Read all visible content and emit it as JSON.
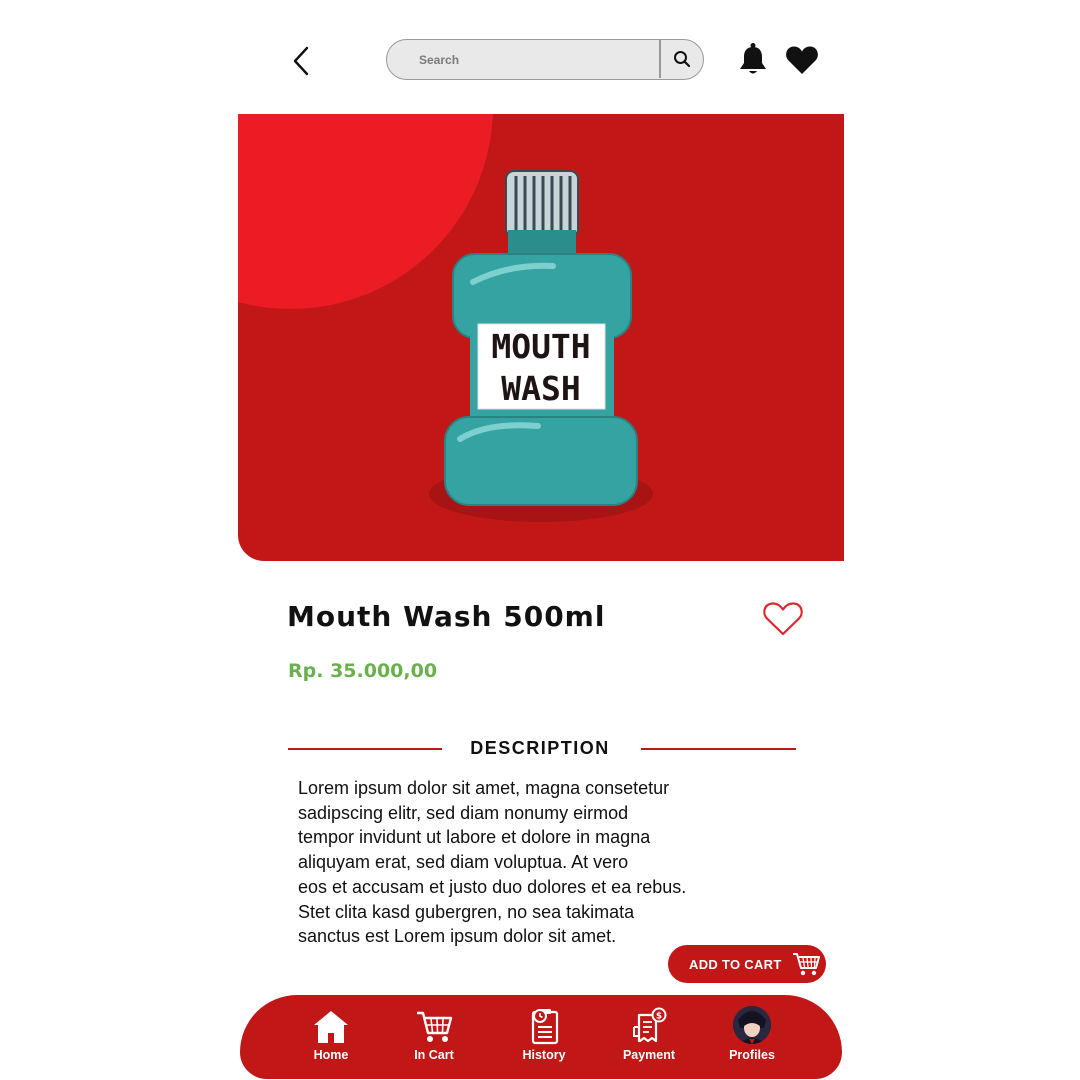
{
  "header": {
    "search_placeholder": "Search",
    "icons": {
      "back": "chevron-left-icon",
      "search": "magnifier-icon",
      "notifications": "bell-icon",
      "wishlist": "heart-icon"
    }
  },
  "hero": {
    "label_line1": "MOUTH",
    "label_line2": "WASH",
    "colors": {
      "background": "#c11717",
      "circle": "#ec1c24",
      "bottle": "#35a3a2"
    }
  },
  "product": {
    "name": "Mouth Wash 500ml",
    "price": "Rp. 35.000,00",
    "favorite": false
  },
  "description": {
    "heading": "DESCRIPTION",
    "lines": [
      "Lorem ipsum dolor sit amet, magna consetetur",
      "sadipscing elitr, sed diam nonumy eirmod",
      "tempor invidunt ut labore et dolore in magna",
      "aliquyam erat, sed diam voluptua. At vero",
      "eos et accusam et justo duo dolores et ea rebus.",
      "Stet clita kasd gubergren, no sea takimata",
      "sanctus est Lorem ipsum dolor sit amet."
    ]
  },
  "add_to_cart": {
    "label": "ADD TO CART",
    "icon": "cart-icon"
  },
  "bottom_nav": {
    "items": [
      {
        "label": "Home",
        "icon": "home-icon",
        "active": true
      },
      {
        "label": "In Cart",
        "icon": "cart-icon"
      },
      {
        "label": "History",
        "icon": "clipboard-clock-icon"
      },
      {
        "label": "Payment",
        "icon": "receipt-icon"
      },
      {
        "label": "Profiles",
        "icon": "avatar"
      }
    ]
  },
  "theme": {
    "primary": "#c11717",
    "price_green": "#6ab04c"
  }
}
